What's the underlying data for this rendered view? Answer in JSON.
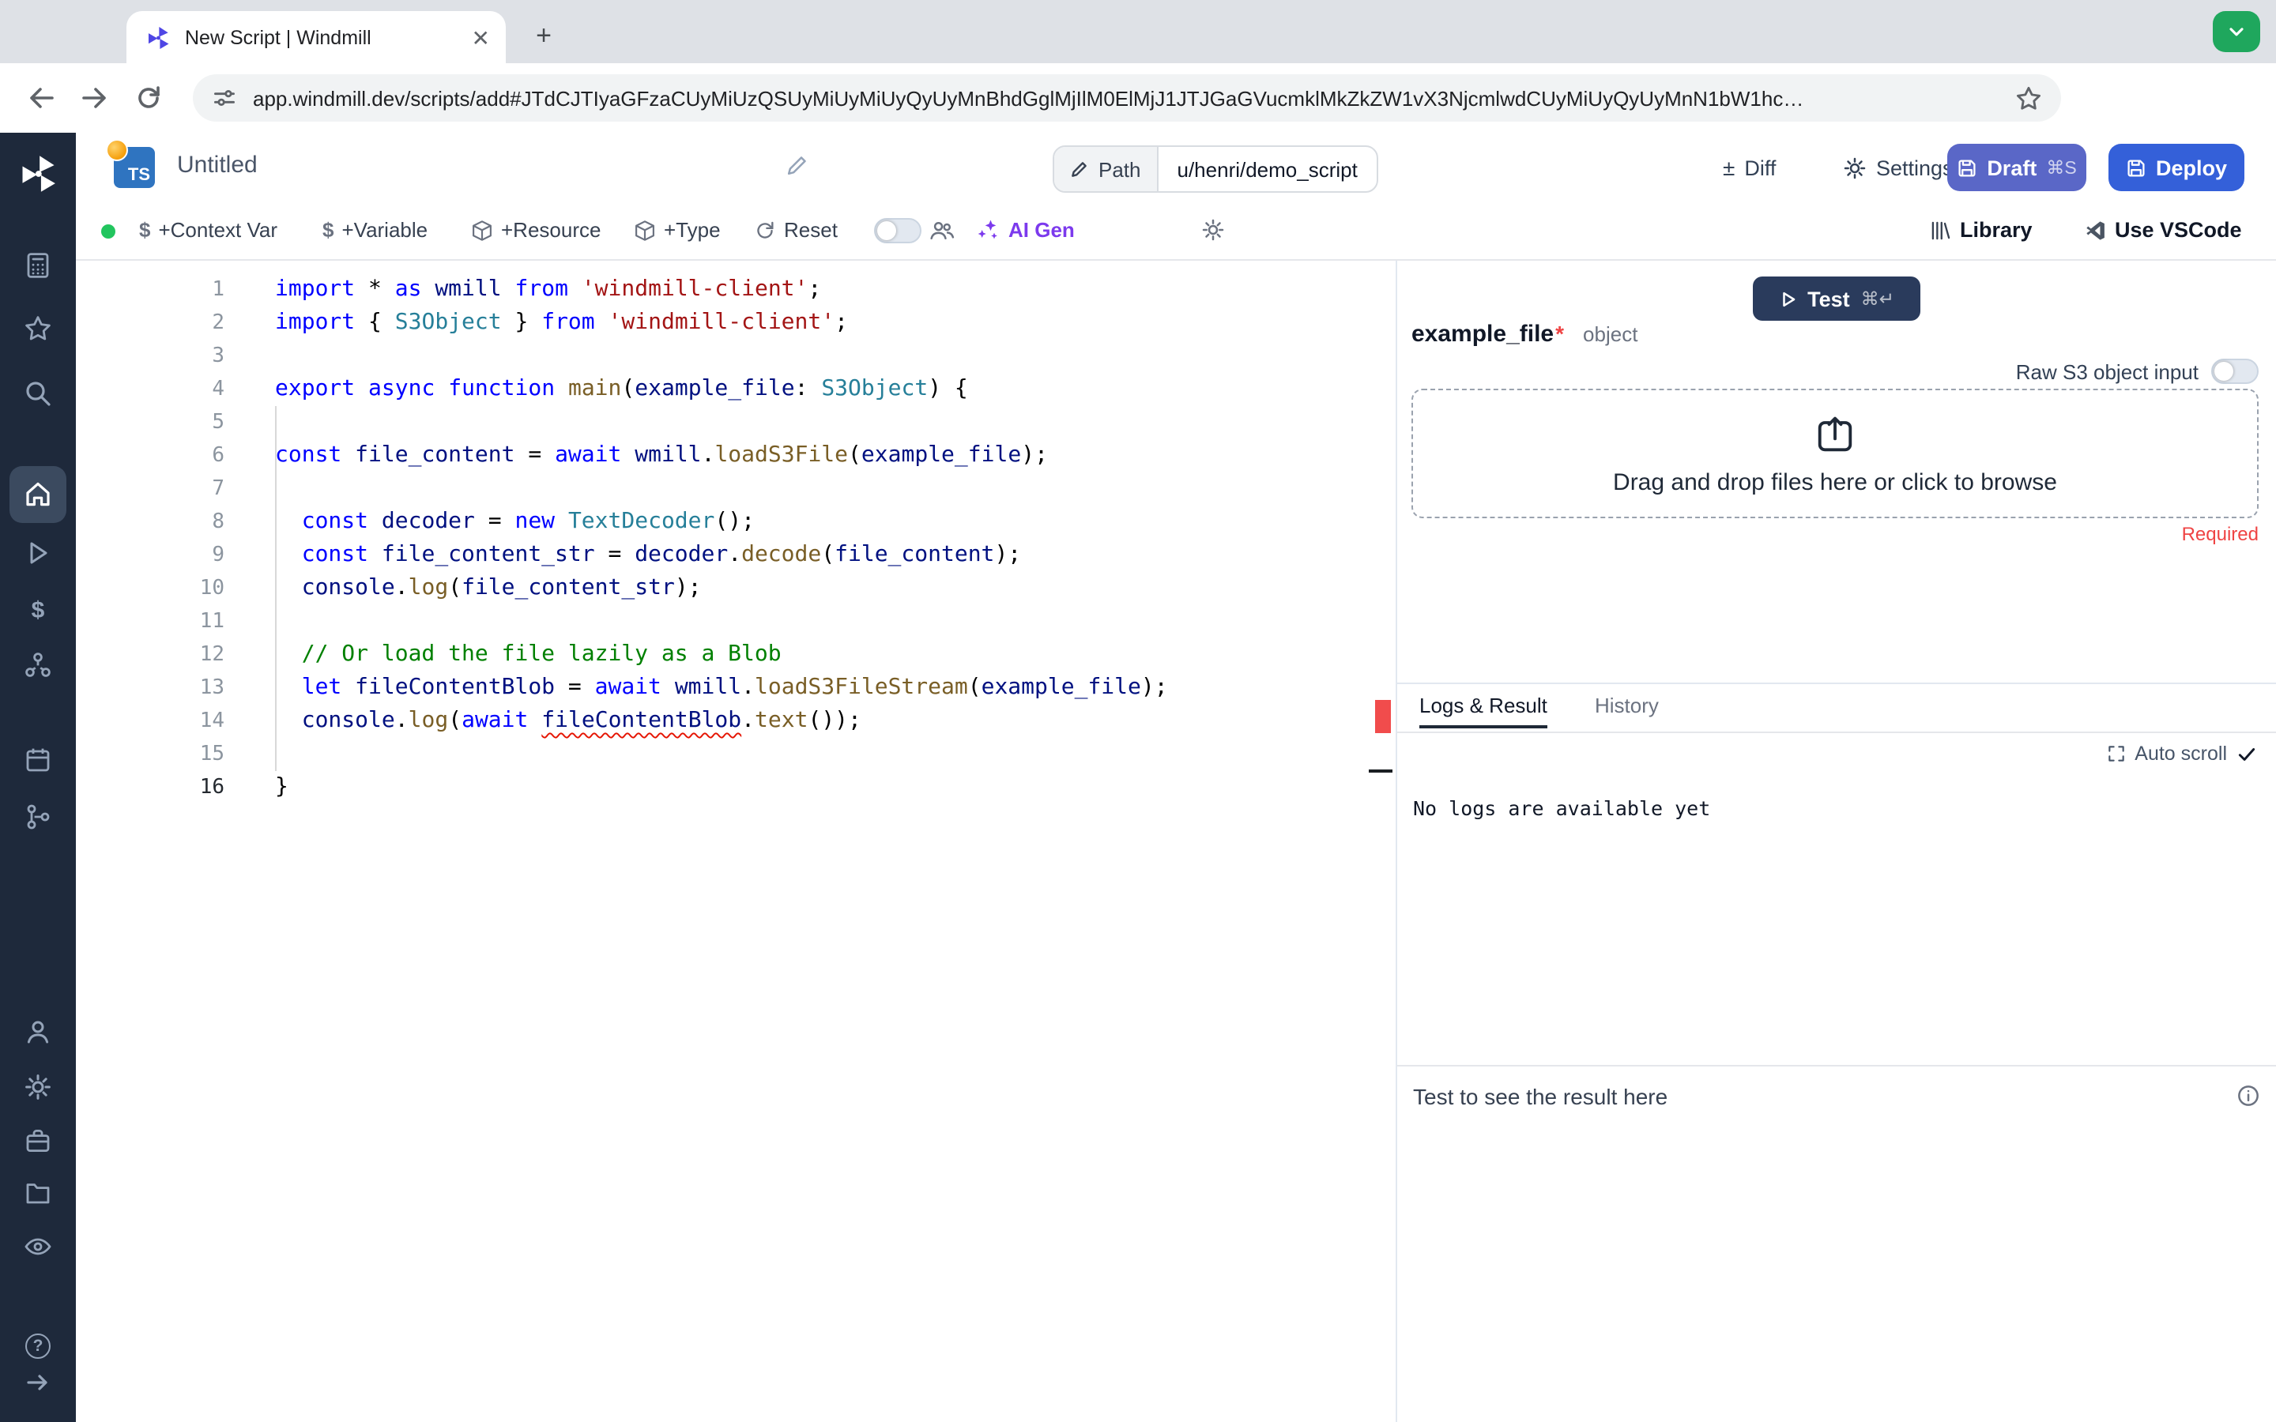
{
  "browser": {
    "tab_title": "New Script | Windmill",
    "url": "app.windmill.dev/scripts/add#JTdCJTIyaGFzaCUyMiUzQSUyMiUyMiUyQyUyMnBhdGglMjIlM0ElMjJ1JTJGaGVucmklMkZkZW1vX3NjcmlwdCUyMiUyQyUyMnN1bW1hc…",
    "accent_green": "#1fa75d"
  },
  "sidebar": {
    "items": [
      {
        "icon": "calculator"
      },
      {
        "icon": "star"
      },
      {
        "icon": "search"
      },
      {
        "icon": "home",
        "active": true
      },
      {
        "icon": "play"
      },
      {
        "icon": "dollar"
      },
      {
        "icon": "hub"
      },
      {
        "icon": "calendar"
      },
      {
        "icon": "flow"
      },
      {
        "icon": "person"
      },
      {
        "icon": "gear"
      },
      {
        "icon": "briefcase"
      },
      {
        "icon": "folder"
      },
      {
        "icon": "eye"
      },
      {
        "icon": "help"
      },
      {
        "icon": "arrow-right"
      }
    ]
  },
  "header": {
    "lang_badge": "TS",
    "title": "Untitled",
    "path_label": "Path",
    "path_value": "u/henri/demo_script",
    "diff": "Diff",
    "settings": "Settings",
    "draft": "Draft",
    "draft_kbd": "⌘S",
    "deploy": "Deploy"
  },
  "toolbar": {
    "context_var": "+Context Var",
    "variable": "+Variable",
    "resource": "+Resource",
    "type": "+Type",
    "reset": "Reset",
    "ai_gen": "AI Gen",
    "library": "Library",
    "use_vscode": "Use VSCode"
  },
  "editor": {
    "active_line": 16,
    "lines": [
      {
        "n": 1,
        "tokens": [
          [
            "k",
            "import"
          ],
          [
            "p",
            " * "
          ],
          [
            "k",
            "as"
          ],
          [
            "v",
            " wmill "
          ],
          [
            "k",
            "from"
          ],
          [
            "p",
            " "
          ],
          [
            "s",
            "'windmill-client'"
          ],
          [
            "p",
            ";"
          ]
        ]
      },
      {
        "n": 2,
        "tokens": [
          [
            "k",
            "import"
          ],
          [
            "p",
            " { "
          ],
          [
            "t",
            "S3Object"
          ],
          [
            "p",
            " } "
          ],
          [
            "k",
            "from"
          ],
          [
            "p",
            " "
          ],
          [
            "s",
            "'windmill-client'"
          ],
          [
            "p",
            ";"
          ]
        ]
      },
      {
        "n": 3,
        "tokens": []
      },
      {
        "n": 4,
        "tokens": [
          [
            "k",
            "export"
          ],
          [
            "p",
            " "
          ],
          [
            "k",
            "async"
          ],
          [
            "p",
            " "
          ],
          [
            "k",
            "function"
          ],
          [
            "p",
            " "
          ],
          [
            "f",
            "main"
          ],
          [
            "p",
            "("
          ],
          [
            "v",
            "example_file"
          ],
          [
            "p",
            ": "
          ],
          [
            "t",
            "S3Object"
          ],
          [
            "p",
            ") {"
          ]
        ]
      },
      {
        "n": 5,
        "tokens": []
      },
      {
        "n": 6,
        "tokens": [
          [
            "k",
            "const"
          ],
          [
            "v",
            " file_content "
          ],
          [
            "p",
            "= "
          ],
          [
            "k",
            "await"
          ],
          [
            "p",
            " "
          ],
          [
            "v",
            "wmill"
          ],
          [
            "p",
            "."
          ],
          [
            "f",
            "loadS3File"
          ],
          [
            "p",
            "("
          ],
          [
            "v",
            "example_file"
          ],
          [
            "p",
            ");"
          ]
        ]
      },
      {
        "n": 7,
        "tokens": []
      },
      {
        "n": 8,
        "tokens": [
          [
            "p",
            "  "
          ],
          [
            "k",
            "const"
          ],
          [
            "v",
            " decoder "
          ],
          [
            "p",
            "= "
          ],
          [
            "k",
            "new"
          ],
          [
            "p",
            " "
          ],
          [
            "t",
            "TextDecoder"
          ],
          [
            "p",
            "();"
          ]
        ]
      },
      {
        "n": 9,
        "tokens": [
          [
            "p",
            "  "
          ],
          [
            "k",
            "const"
          ],
          [
            "v",
            " file_content_str "
          ],
          [
            "p",
            "= "
          ],
          [
            "v",
            "decoder"
          ],
          [
            "p",
            "."
          ],
          [
            "f",
            "decode"
          ],
          [
            "p",
            "("
          ],
          [
            "v",
            "file_content"
          ],
          [
            "p",
            ");"
          ]
        ]
      },
      {
        "n": 10,
        "tokens": [
          [
            "p",
            "  "
          ],
          [
            "v",
            "console"
          ],
          [
            "p",
            "."
          ],
          [
            "f",
            "log"
          ],
          [
            "p",
            "("
          ],
          [
            "v",
            "file_content_str"
          ],
          [
            "p",
            ");"
          ]
        ]
      },
      {
        "n": 11,
        "tokens": []
      },
      {
        "n": 12,
        "tokens": [
          [
            "p",
            "  "
          ],
          [
            "c",
            "// Or load the file lazily as a Blob"
          ]
        ]
      },
      {
        "n": 13,
        "tokens": [
          [
            "p",
            "  "
          ],
          [
            "k",
            "let"
          ],
          [
            "v",
            " fileContentBlob "
          ],
          [
            "p",
            "= "
          ],
          [
            "k",
            "await"
          ],
          [
            "p",
            " "
          ],
          [
            "v",
            "wmill"
          ],
          [
            "p",
            "."
          ],
          [
            "f",
            "loadS3FileStream"
          ],
          [
            "p",
            "("
          ],
          [
            "v",
            "example_file"
          ],
          [
            "p",
            ");"
          ]
        ]
      },
      {
        "n": 14,
        "tokens": [
          [
            "p",
            "  "
          ],
          [
            "v",
            "console"
          ],
          [
            "p",
            "."
          ],
          [
            "f",
            "log"
          ],
          [
            "p",
            "("
          ],
          [
            "k",
            "await"
          ],
          [
            "p",
            " "
          ],
          [
            "ve",
            "fileContentBlob"
          ],
          [
            "p",
            "."
          ],
          [
            "f",
            "text"
          ],
          [
            "p",
            "());"
          ]
        ]
      },
      {
        "n": 15,
        "tokens": []
      },
      {
        "n": 16,
        "tokens": [
          [
            "p",
            "}"
          ]
        ]
      }
    ]
  },
  "right": {
    "test_label": "Test",
    "test_kbd": "⌘↵",
    "arg_name": "example_file",
    "arg_required_mark": "*",
    "arg_type": "object",
    "raw_s3_label": "Raw S3 object input",
    "dropzone_text": "Drag and drop files here or click to browse",
    "required": "Required",
    "tabs": {
      "logs": "Logs & Result",
      "history": "History"
    },
    "auto_scroll": "Auto scroll",
    "no_logs": "No logs are available yet",
    "result_placeholder": "Test to see the result here"
  }
}
